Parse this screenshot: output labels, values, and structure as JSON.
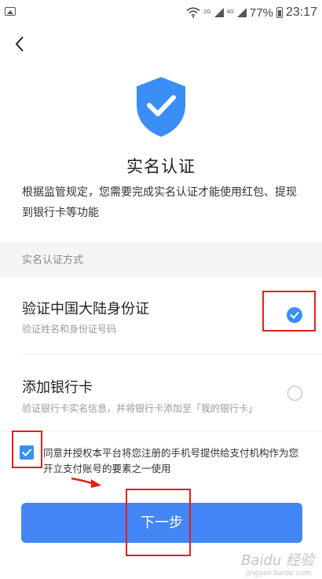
{
  "status_bar": {
    "network": "2G",
    "network2": "4G",
    "battery": "77%",
    "time": "23:17"
  },
  "page": {
    "title": "实名认证",
    "description": "根据监管规定，您需要完成实名认证才能使用红包、提现到银行卡等功能"
  },
  "section": {
    "label": "实名认证方式"
  },
  "options": [
    {
      "title": "验证中国大陆身份证",
      "subtitle": "验证姓名和身份证号码",
      "selected": true
    },
    {
      "title": "添加银行卡",
      "subtitle": "验证银行卡实名信息，并将银行卡添加至「我的银行卡」",
      "selected": false
    }
  ],
  "agreement": {
    "text": "同意并授权本平台将您注册的手机号提供给支付机构作为您开立支付账号的要素之一使用",
    "checked": true
  },
  "next_button": {
    "label": "下一步"
  },
  "watermark": {
    "brand": "Baidu 经验",
    "url": "jingyan.baidu.com"
  },
  "colors": {
    "accent": "#3a8ef6",
    "button": "#4485f5",
    "annotation": "#e3201b"
  }
}
